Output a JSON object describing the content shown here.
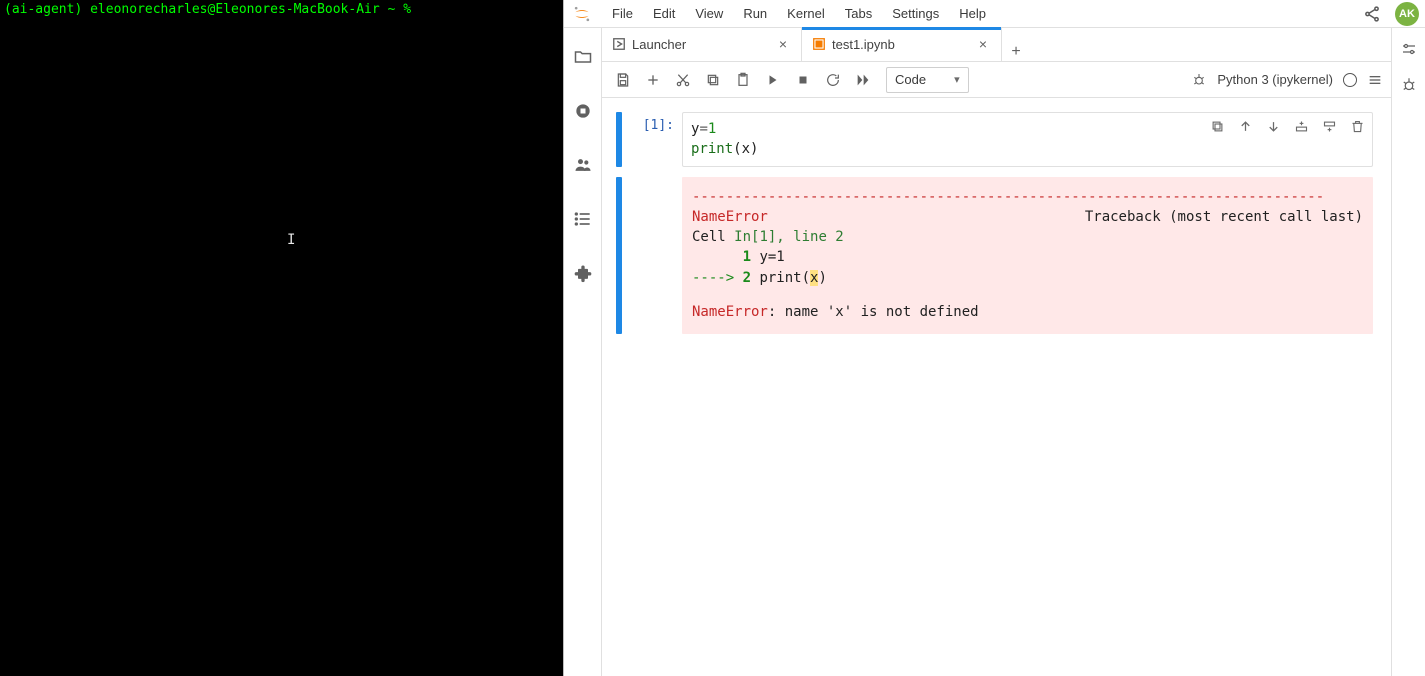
{
  "terminal": {
    "prompt_env": "(ai-agent)",
    "prompt_user": " eleonorecharles@Eleonores-MacBook-Air ~ ",
    "prompt_symbol": "%"
  },
  "menubar": {
    "items": [
      "File",
      "Edit",
      "View",
      "Run",
      "Kernel",
      "Tabs",
      "Settings",
      "Help"
    ]
  },
  "avatar_initials": "AK",
  "tabs": [
    {
      "label": "Launcher",
      "active": false,
      "icon": "launcher"
    },
    {
      "label": "test1.ipynb",
      "active": true,
      "icon": "notebook"
    }
  ],
  "toolbar": {
    "cell_type": "Code"
  },
  "kernel": {
    "name": "Python 3 (ipykernel)"
  },
  "cell": {
    "prompt": "[1]:",
    "code_line1_lhs": "y",
    "code_line1_eq": "=",
    "code_line1_rhs": "1",
    "code_line2_func": "print",
    "code_line2_args": "(x)"
  },
  "error": {
    "dashes": "---------------------------------------------------------------------------",
    "name": "NameError",
    "traceback_label": "Traceback (most recent call last)",
    "cell_label_prefix": "Cell ",
    "cell_label_loc": "In[1], line 2",
    "line1_no": "1",
    "line1_body": " y=1",
    "arrow": "----> ",
    "line2_no": "2",
    "line2_body_func": " print(",
    "line2_body_hl": "x",
    "line2_body_close": ")",
    "final_prefix": "NameError",
    "final_rest": ": name 'x' is not defined"
  }
}
